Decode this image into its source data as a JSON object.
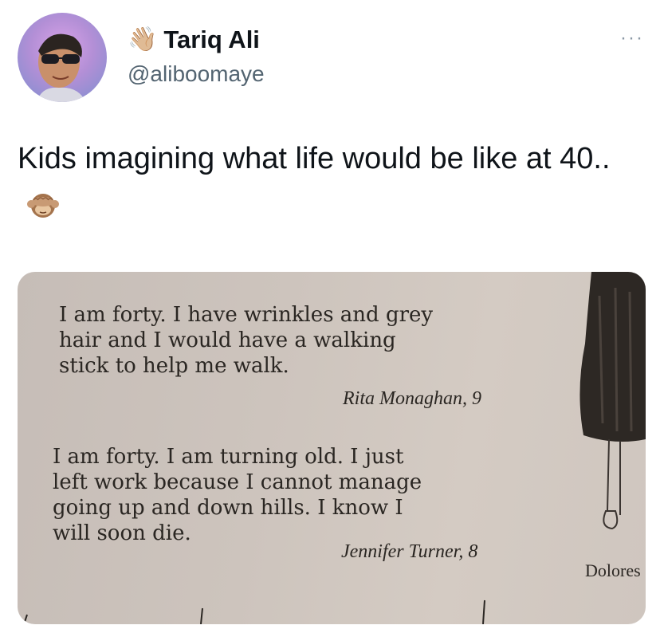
{
  "author": {
    "display_name": "Tariq Ali",
    "handle": "@aliboomaye",
    "name_emoji": "👋🏼",
    "avatar_icon": "profile-photo"
  },
  "more_label": "···",
  "tweet": {
    "text": "Kids imagining what life would be like at 40..",
    "emoji_icon": "see-no-evil-monkey"
  },
  "photo": {
    "quote1": {
      "lines": [
        "I am forty. I have wrinkles and grey",
        "hair and I would have a walking",
        "stick to help me walk."
      ],
      "signature": "Rita Monaghan, 9"
    },
    "quote2": {
      "lines": [
        "I am forty. I am turning old. I just",
        "left work because I cannot manage",
        "going up and down hills. I know I",
        "will soon die."
      ],
      "signature": "Jennifer Turner, 8"
    },
    "cut_caption": "Dolores"
  },
  "colors": {
    "text": "#0f1419",
    "secondary": "#536471",
    "paper": "#cdc4bd"
  }
}
